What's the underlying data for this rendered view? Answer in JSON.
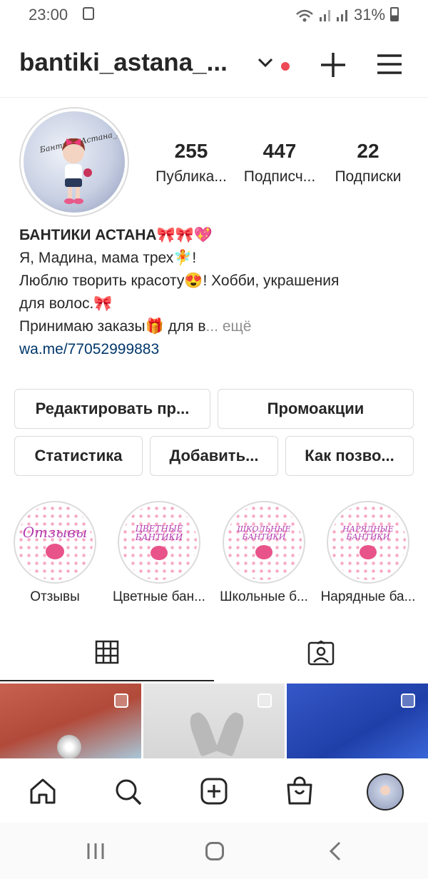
{
  "status_bar": {
    "time": "23:00",
    "battery": "31%"
  },
  "header": {
    "username": "bantiki_astana_..."
  },
  "stats": [
    {
      "value": "255",
      "label": "Публика..."
    },
    {
      "value": "447",
      "label": "Подписч..."
    },
    {
      "value": "22",
      "label": "Подписки"
    }
  ],
  "bio": {
    "name": "БАНТИКИ АСТАНА🎀🎀💖",
    "line1": "Я, Мадина, мама трех🧚!",
    "line2": "Люблю творить красоту😍! Хобби, украшения",
    "line3": "для волос.🎀",
    "line4": "Принимаю заказы🎁 для в",
    "more": "... ещё",
    "link": "wa.me/77052999883"
  },
  "buttons": {
    "edit": "Редактировать пр...",
    "promo": "Промоакции",
    "stats": "Статистика",
    "add": "Добавить...",
    "how": "Как позво..."
  },
  "highlights": [
    {
      "cover_text": "Отзывы",
      "label": "Отзывы"
    },
    {
      "cover_text": "ЦВЕТНЫЕ БАНТИКИ",
      "label": "Цветные бан..."
    },
    {
      "cover_text": "ШКОЛЬНЫЕ БАНТИКИ",
      "label": "Школьные б..."
    },
    {
      "cover_text": "НАРЯДНЫЕ БАНТИКИ",
      "label": "Нарядные ба..."
    }
  ],
  "avatar_text": "Бантики_Астана_На_Заказ",
  "colors": {
    "accent_link": "#00376b",
    "notification_dot": "#ed4956",
    "highlight_dots": "#f7a9c5"
  },
  "icons": [
    "grid-icon",
    "tagged-icon",
    "home-icon",
    "search-icon",
    "new-post-icon",
    "shop-icon",
    "profile-avatar-icon"
  ]
}
